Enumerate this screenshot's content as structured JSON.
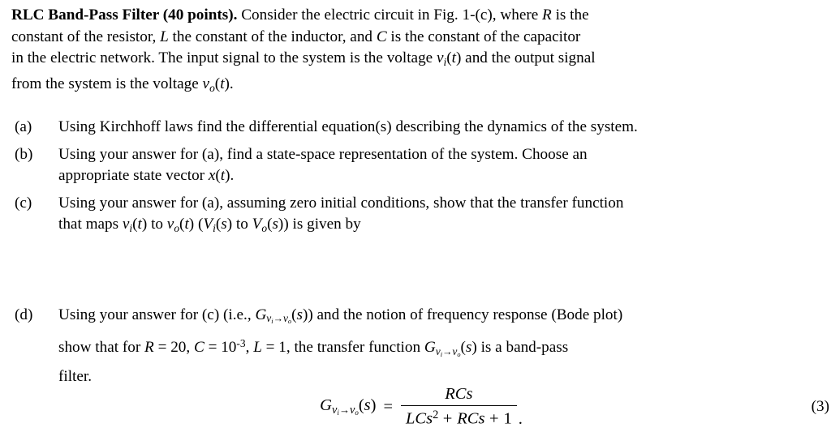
{
  "document": {
    "type": "problem-statement",
    "background_color": "#ffffff",
    "text_color": "#000000"
  },
  "intro": {
    "title": "RLC Band-Pass Filter (40 points).",
    "lines": [
      {
        "id": "intro-line-1",
        "segments": [
          {
            "kind": "bold",
            "text": "RLC Band-Pass Filter (40 points)."
          },
          {
            "kind": "text",
            "text": " Consider the electric circuit in Fig. 1-(c), where "
          },
          {
            "kind": "math",
            "text": "R"
          },
          {
            "kind": "text",
            "text": " is the"
          }
        ]
      },
      {
        "id": "intro-line-2",
        "segments": [
          {
            "kind": "text",
            "text": "constant of the resistor, "
          },
          {
            "kind": "math",
            "text": "L"
          },
          {
            "kind": "text",
            "text": " the constant of the inductor, and "
          },
          {
            "kind": "math",
            "text": "C"
          },
          {
            "kind": "text",
            "text": " is the constant of the capacitor"
          }
        ]
      },
      {
        "id": "intro-line-3",
        "segments": [
          {
            "kind": "text",
            "text": "in the electric network. The input signal to the system is the voltage "
          },
          {
            "kind": "math-vi-t",
            "text": "v_i(t)"
          },
          {
            "kind": "text",
            "text": " and the output signal"
          }
        ]
      },
      {
        "id": "intro-line-4",
        "segments": [
          {
            "kind": "text",
            "text": "from the system is the voltage "
          },
          {
            "kind": "math-vo-t",
            "text": "v_o(t)"
          },
          {
            "kind": "text",
            "text": "."
          }
        ]
      }
    ],
    "plain_text": "RLC Band-Pass Filter (40 points). Consider the electric circuit in Fig. 1-(c), where R is the constant of the resistor, L the constant of the inductor, and C is the constant of the capacitor in the electric network. The input signal to the system is the voltage vi(t) and the output signal from the system is the voltage vo(t)."
  },
  "items": [
    {
      "label": "(a)",
      "lines": [
        "Using Kirchhoff laws find the differential equation(s) describing the dynamics of the system."
      ],
      "plain_text": "Using Kirchhoff laws find the differential equation(s) describing the dynamics of the system."
    },
    {
      "label": "(b)",
      "lines": [
        "Using  your  answer  for  (a),  find  a  state-space  representation  of  the  system.    Choose  an",
        "appropriate state vector x(t)."
      ],
      "plain_text": "Using your answer for (a), find a state-space representation of the system. Choose an appropriate state vector x(t)."
    },
    {
      "label": "(c)",
      "lines": [
        "Using your answer for (a), assuming zero initial conditions, show that the transfer function",
        "that maps vi(t) to vo(t) (Vi(s) to Vo(s)) is given by"
      ],
      "plain_text": "Using your answer for (a), assuming zero initial conditions, show that the transfer function that maps vi(t) to vo(t) (Vi(s) to Vo(s)) is given by"
    },
    {
      "label": "(d)",
      "lines": [
        "Using your answer for (c) (i.e., Gvi→vo(s)) and the notion of frequency response (Bode plot)",
        "show  that  for  R = 20,  C = 10-3,  L = 1,  the  transfer  function  Gvi→vo(s)  is  a  band-pass",
        "filter."
      ],
      "plain_text": "Using your answer for (c) (i.e., Gvi→vo(s)) and the notion of frequency response (Bode plot) show that for R = 20, C = 10^-3, L = 1, the transfer function Gvi→vo(s) is a band-pass filter."
    }
  ],
  "equation": {
    "number": "(3)",
    "lhs_symbol": "G",
    "lhs_subscript_from": "v",
    "lhs_subscript_from_index": "i",
    "lhs_subscript_arrow": "→",
    "lhs_subscript_to": "v",
    "lhs_subscript_to_index": "o",
    "lhs_argument": "(s)",
    "relation": "=",
    "numerator": "RCs",
    "denominator_terms": [
      "LCs",
      "2",
      "+",
      "RCs",
      "+",
      "1"
    ],
    "denominator": "LCs² + RCs + 1",
    "trailing_punctuation": ".",
    "latex": "G_{v_i \\to v_o}(s) = \\frac{RCs}{LCs^2 + RCs + 1}."
  },
  "parameters": {
    "R": "20",
    "C": "10-3",
    "C_base": "10",
    "C_exponent": "-3",
    "L": "1"
  },
  "symbols": {
    "v": "v",
    "i": "i",
    "o": "o",
    "t": "t",
    "s": "s",
    "x": "x",
    "G": "G",
    "V": "V",
    "R": "R",
    "L": "L",
    "C": "C",
    "arrow": "→",
    "equals": "=",
    "plus": "+",
    "two": "2"
  },
  "fragments": {
    "intro_1a": " Consider the electric circuit in Fig. 1-(c), where ",
    "intro_1b": " is the",
    "intro_2a": "constant of the resistor, ",
    "intro_2b": " the constant of the inductor, and ",
    "intro_2c": " is the constant of the capacitor",
    "intro_3a": "in the electric network. The input signal to the system is the voltage ",
    "intro_3b": " and the output signal",
    "intro_4a": "from the system is the voltage ",
    "intro_4b": ".",
    "b_line2a": "appropriate state vector ",
    "b_line2b": ".",
    "c_line2a": "that maps ",
    "c_line2b": " to ",
    "c_line2c": " (",
    "c_line2d": " to ",
    "c_line2e": ") is given by",
    "d_line1a": "Using your answer for (c) (i.e., ",
    "d_line1b": ") and the notion of frequency response (Bode plot)",
    "d_line2a": "show  that  for ",
    "d_line2b": " = 20, ",
    "d_line2c": " = 10",
    "d_line2d": ", ",
    "d_line2e": " = 1,  the  transfer  function ",
    "d_line2f": "  is  a  band-pass",
    "d_line3": "filter."
  }
}
